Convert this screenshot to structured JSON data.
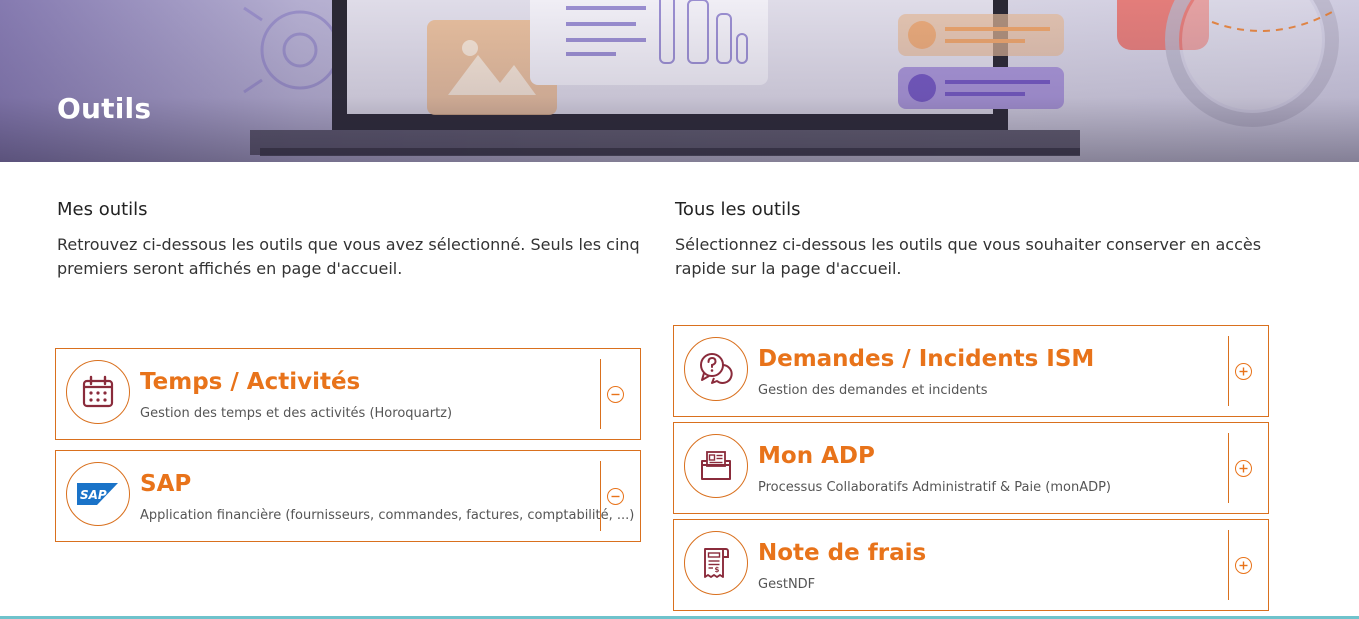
{
  "header": {
    "title": "Outils"
  },
  "my_tools": {
    "title": "Mes outils",
    "description": "Retrouvez ci-dessous les outils que vous avez sélectionné. Seuls les cinq premiers seront affichés en page d'accueil.",
    "items": [
      {
        "title": "Temps / Activités",
        "subtitle": "Gestion des temps et des activités (Horoquartz)",
        "icon": "calendar-icon",
        "action": "remove"
      },
      {
        "title": "SAP",
        "subtitle": "Application financière (fournisseurs, commandes, factures, comptabilité, ...)",
        "icon": "sap-logo",
        "logo_text": "SAP",
        "action": "remove"
      }
    ]
  },
  "all_tools": {
    "title": "Tous les outils",
    "description": "Sélectionnez ci-dessous les outils que vous souhaiter conserver en accès rapide sur la page d'accueil.",
    "items": [
      {
        "title": "Demandes / Incidents ISM",
        "subtitle": "Gestion des demandes et incidents",
        "icon": "help-chat-icon",
        "action": "add"
      },
      {
        "title": "Mon ADP",
        "subtitle": "Processus Collaboratifs Administratif & Paie (monADP)",
        "icon": "folder-document-icon",
        "action": "add"
      },
      {
        "title": "Note de frais",
        "subtitle": "GestNDF",
        "icon": "receipt-icon",
        "action": "add"
      }
    ]
  },
  "colors": {
    "accent": "#e8731a",
    "border": "#d9701e",
    "icon_dark": "#8a2b3b"
  }
}
